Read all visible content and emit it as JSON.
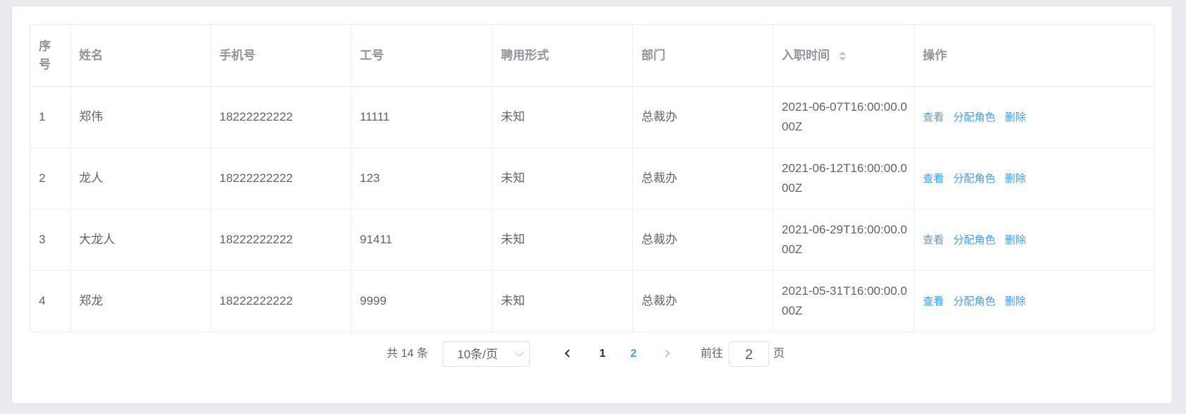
{
  "table": {
    "columns": [
      "序号",
      "姓名",
      "手机号",
      "工号",
      "聘用形式",
      "部门",
      "入职时间",
      "操作"
    ],
    "header_index_line1": "序",
    "header_index_line2": "号",
    "rows": [
      {
        "index": "1",
        "name": "郑伟",
        "phone": "18222222222",
        "job_no": "11111",
        "employment": "未知",
        "department": "总裁办",
        "hire_time": "2021-06-07T16:00:00.000Z"
      },
      {
        "index": "2",
        "name": "龙人",
        "phone": "18222222222",
        "job_no": "123",
        "employment": "未知",
        "department": "总裁办",
        "hire_time": "2021-06-12T16:00:00.000Z"
      },
      {
        "index": "3",
        "name": "大龙人",
        "phone": "18222222222",
        "job_no": "91411",
        "employment": "未知",
        "department": "总裁办",
        "hire_time": "2021-06-29T16:00:00.000Z"
      },
      {
        "index": "4",
        "name": "郑龙",
        "phone": "18222222222",
        "job_no": "9999",
        "employment": "未知",
        "department": "总裁办",
        "hire_time": "2021-05-31T16:00:00.000Z"
      }
    ],
    "actions": {
      "view": "查看",
      "assign_role": "分配角色",
      "delete": "删除"
    }
  },
  "pagination": {
    "total_label": "共 14 条",
    "page_size": "10条/页",
    "pages": [
      "1",
      "2"
    ],
    "current_page": "2",
    "goto_label": "前往",
    "goto_value": "2",
    "goto_unit": "页"
  },
  "colors": {
    "link": "#409eff",
    "header_text": "#909399",
    "border": "#ebeef5"
  },
  "icons": [
    "sort-caret-icon",
    "chevron-down-icon",
    "chevron-left-icon",
    "chevron-right-icon"
  ]
}
